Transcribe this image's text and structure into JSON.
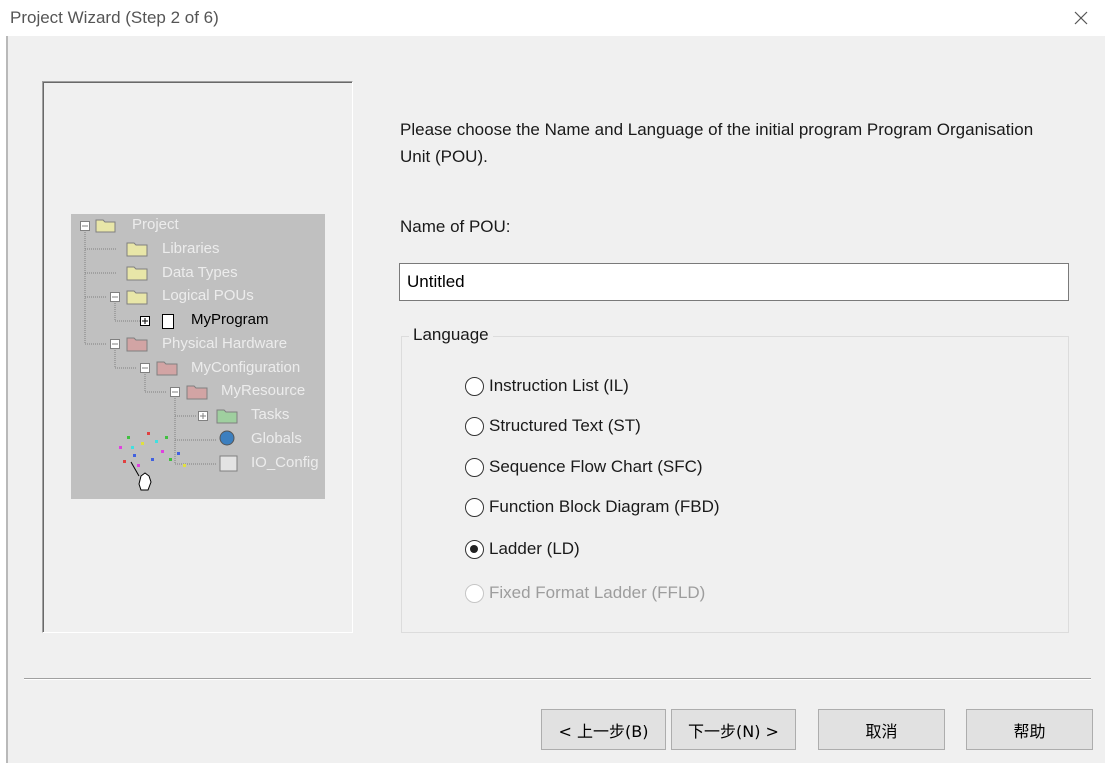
{
  "window": {
    "title": "Project Wizard (Step 2 of 6)",
    "close_icon": "close-icon"
  },
  "illustration": {
    "tree": [
      {
        "label": "Project",
        "icon": "folder-open-icon",
        "state": "disabled"
      },
      {
        "label": "Libraries",
        "icon": "folder-icon",
        "state": "disabled"
      },
      {
        "label": "Data Types",
        "icon": "folder-icon",
        "state": "disabled"
      },
      {
        "label": "Logical POUs",
        "icon": "folder-open-icon",
        "state": "disabled"
      },
      {
        "label": "MyProgram",
        "icon": "pou-icon",
        "state": "active"
      },
      {
        "label": "Physical Hardware",
        "icon": "hardware-folder-icon",
        "state": "disabled"
      },
      {
        "label": "MyConfiguration",
        "icon": "configuration-icon",
        "state": "disabled"
      },
      {
        "label": "MyResource",
        "icon": "resource-icon",
        "state": "disabled"
      },
      {
        "label": "Tasks",
        "icon": "tasks-folder-icon",
        "state": "disabled"
      },
      {
        "label": "Globals",
        "icon": "globals-icon",
        "state": "disabled"
      },
      {
        "label": "IO_Config",
        "icon": "io-config-icon",
        "state": "disabled"
      }
    ],
    "wand_icon": "magic-wand-hand-icon"
  },
  "instructions": "Please choose the Name and Language of the initial program Program Organisation Unit (POU).",
  "pou_name": {
    "label": "Name of POU:",
    "value": "Untitled"
  },
  "language": {
    "legend": "Language",
    "options": [
      {
        "label": "Instruction List (IL)",
        "checked": false,
        "disabled": false
      },
      {
        "label": "Structured Text (ST)",
        "checked": false,
        "disabled": false
      },
      {
        "label": "Sequence Flow Chart (SFC)",
        "checked": false,
        "disabled": false
      },
      {
        "label": "Function Block Diagram (FBD)",
        "checked": false,
        "disabled": false
      },
      {
        "label": "Ladder (LD)",
        "checked": true,
        "disabled": false
      },
      {
        "label": "Fixed Format Ladder (FFLD)",
        "checked": false,
        "disabled": true
      }
    ]
  },
  "buttons": {
    "back": "< 上一步(B)",
    "next": "下一步(N) >",
    "cancel": "取消",
    "help": "帮助"
  },
  "colors": {
    "dialog_bg": "#f0f0f0",
    "illustration_bg": "#c0c0c0",
    "disabled_text": "#9d9d9d"
  }
}
